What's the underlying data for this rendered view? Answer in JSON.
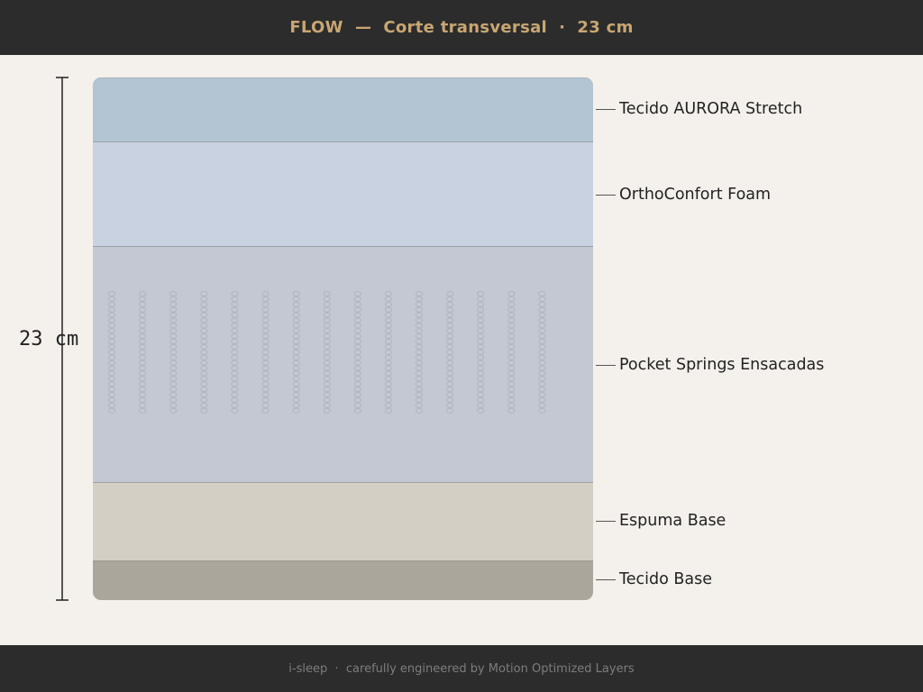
{
  "header": {
    "title": "FLOW  —  Corte transversal  ·  23 cm"
  },
  "dimension": {
    "label": "23 cm"
  },
  "layers": [
    {
      "name": "Tecido AURORA Stretch"
    },
    {
      "name": "OrthoConfort Foam"
    },
    {
      "name": "Pocket Springs Ensacadas"
    },
    {
      "name": "Espuma Base"
    },
    {
      "name": "Tecido Base"
    }
  ],
  "footer": {
    "text": "i-sleep  ·  carefully engineered by Motion Optimized Layers"
  },
  "colors": {
    "header_bg": "#2c2c2c",
    "title_gold": "#c8a673",
    "page_bg": "#f4f0ec"
  }
}
